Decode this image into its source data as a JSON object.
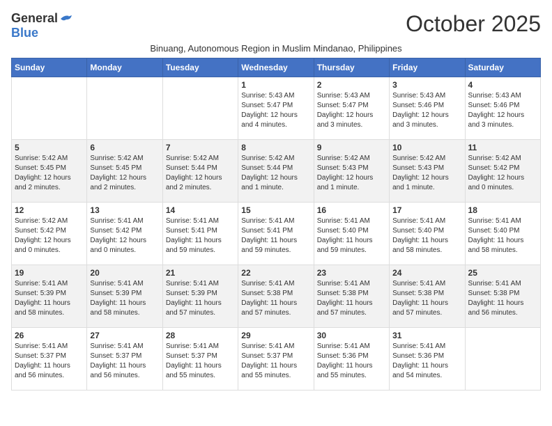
{
  "logo": {
    "general": "General",
    "blue": "Blue"
  },
  "title": "October 2025",
  "subtitle": "Binuang, Autonomous Region in Muslim Mindanao, Philippines",
  "days_of_week": [
    "Sunday",
    "Monday",
    "Tuesday",
    "Wednesday",
    "Thursday",
    "Friday",
    "Saturday"
  ],
  "weeks": [
    [
      {
        "day": "",
        "info": ""
      },
      {
        "day": "",
        "info": ""
      },
      {
        "day": "",
        "info": ""
      },
      {
        "day": "1",
        "info": "Sunrise: 5:43 AM\nSunset: 5:47 PM\nDaylight: 12 hours\nand 4 minutes."
      },
      {
        "day": "2",
        "info": "Sunrise: 5:43 AM\nSunset: 5:47 PM\nDaylight: 12 hours\nand 3 minutes."
      },
      {
        "day": "3",
        "info": "Sunrise: 5:43 AM\nSunset: 5:46 PM\nDaylight: 12 hours\nand 3 minutes."
      },
      {
        "day": "4",
        "info": "Sunrise: 5:43 AM\nSunset: 5:46 PM\nDaylight: 12 hours\nand 3 minutes."
      }
    ],
    [
      {
        "day": "5",
        "info": "Sunrise: 5:42 AM\nSunset: 5:45 PM\nDaylight: 12 hours\nand 2 minutes."
      },
      {
        "day": "6",
        "info": "Sunrise: 5:42 AM\nSunset: 5:45 PM\nDaylight: 12 hours\nand 2 minutes."
      },
      {
        "day": "7",
        "info": "Sunrise: 5:42 AM\nSunset: 5:44 PM\nDaylight: 12 hours\nand 2 minutes."
      },
      {
        "day": "8",
        "info": "Sunrise: 5:42 AM\nSunset: 5:44 PM\nDaylight: 12 hours\nand 1 minute."
      },
      {
        "day": "9",
        "info": "Sunrise: 5:42 AM\nSunset: 5:43 PM\nDaylight: 12 hours\nand 1 minute."
      },
      {
        "day": "10",
        "info": "Sunrise: 5:42 AM\nSunset: 5:43 PM\nDaylight: 12 hours\nand 1 minute."
      },
      {
        "day": "11",
        "info": "Sunrise: 5:42 AM\nSunset: 5:42 PM\nDaylight: 12 hours\nand 0 minutes."
      }
    ],
    [
      {
        "day": "12",
        "info": "Sunrise: 5:42 AM\nSunset: 5:42 PM\nDaylight: 12 hours\nand 0 minutes."
      },
      {
        "day": "13",
        "info": "Sunrise: 5:41 AM\nSunset: 5:42 PM\nDaylight: 12 hours\nand 0 minutes."
      },
      {
        "day": "14",
        "info": "Sunrise: 5:41 AM\nSunset: 5:41 PM\nDaylight: 11 hours\nand 59 minutes."
      },
      {
        "day": "15",
        "info": "Sunrise: 5:41 AM\nSunset: 5:41 PM\nDaylight: 11 hours\nand 59 minutes."
      },
      {
        "day": "16",
        "info": "Sunrise: 5:41 AM\nSunset: 5:40 PM\nDaylight: 11 hours\nand 59 minutes."
      },
      {
        "day": "17",
        "info": "Sunrise: 5:41 AM\nSunset: 5:40 PM\nDaylight: 11 hours\nand 58 minutes."
      },
      {
        "day": "18",
        "info": "Sunrise: 5:41 AM\nSunset: 5:40 PM\nDaylight: 11 hours\nand 58 minutes."
      }
    ],
    [
      {
        "day": "19",
        "info": "Sunrise: 5:41 AM\nSunset: 5:39 PM\nDaylight: 11 hours\nand 58 minutes."
      },
      {
        "day": "20",
        "info": "Sunrise: 5:41 AM\nSunset: 5:39 PM\nDaylight: 11 hours\nand 58 minutes."
      },
      {
        "day": "21",
        "info": "Sunrise: 5:41 AM\nSunset: 5:39 PM\nDaylight: 11 hours\nand 57 minutes."
      },
      {
        "day": "22",
        "info": "Sunrise: 5:41 AM\nSunset: 5:38 PM\nDaylight: 11 hours\nand 57 minutes."
      },
      {
        "day": "23",
        "info": "Sunrise: 5:41 AM\nSunset: 5:38 PM\nDaylight: 11 hours\nand 57 minutes."
      },
      {
        "day": "24",
        "info": "Sunrise: 5:41 AM\nSunset: 5:38 PM\nDaylight: 11 hours\nand 57 minutes."
      },
      {
        "day": "25",
        "info": "Sunrise: 5:41 AM\nSunset: 5:38 PM\nDaylight: 11 hours\nand 56 minutes."
      }
    ],
    [
      {
        "day": "26",
        "info": "Sunrise: 5:41 AM\nSunset: 5:37 PM\nDaylight: 11 hours\nand 56 minutes."
      },
      {
        "day": "27",
        "info": "Sunrise: 5:41 AM\nSunset: 5:37 PM\nDaylight: 11 hours\nand 56 minutes."
      },
      {
        "day": "28",
        "info": "Sunrise: 5:41 AM\nSunset: 5:37 PM\nDaylight: 11 hours\nand 55 minutes."
      },
      {
        "day": "29",
        "info": "Sunrise: 5:41 AM\nSunset: 5:37 PM\nDaylight: 11 hours\nand 55 minutes."
      },
      {
        "day": "30",
        "info": "Sunrise: 5:41 AM\nSunset: 5:36 PM\nDaylight: 11 hours\nand 55 minutes."
      },
      {
        "day": "31",
        "info": "Sunrise: 5:41 AM\nSunset: 5:36 PM\nDaylight: 11 hours\nand 54 minutes."
      },
      {
        "day": "",
        "info": ""
      }
    ]
  ]
}
